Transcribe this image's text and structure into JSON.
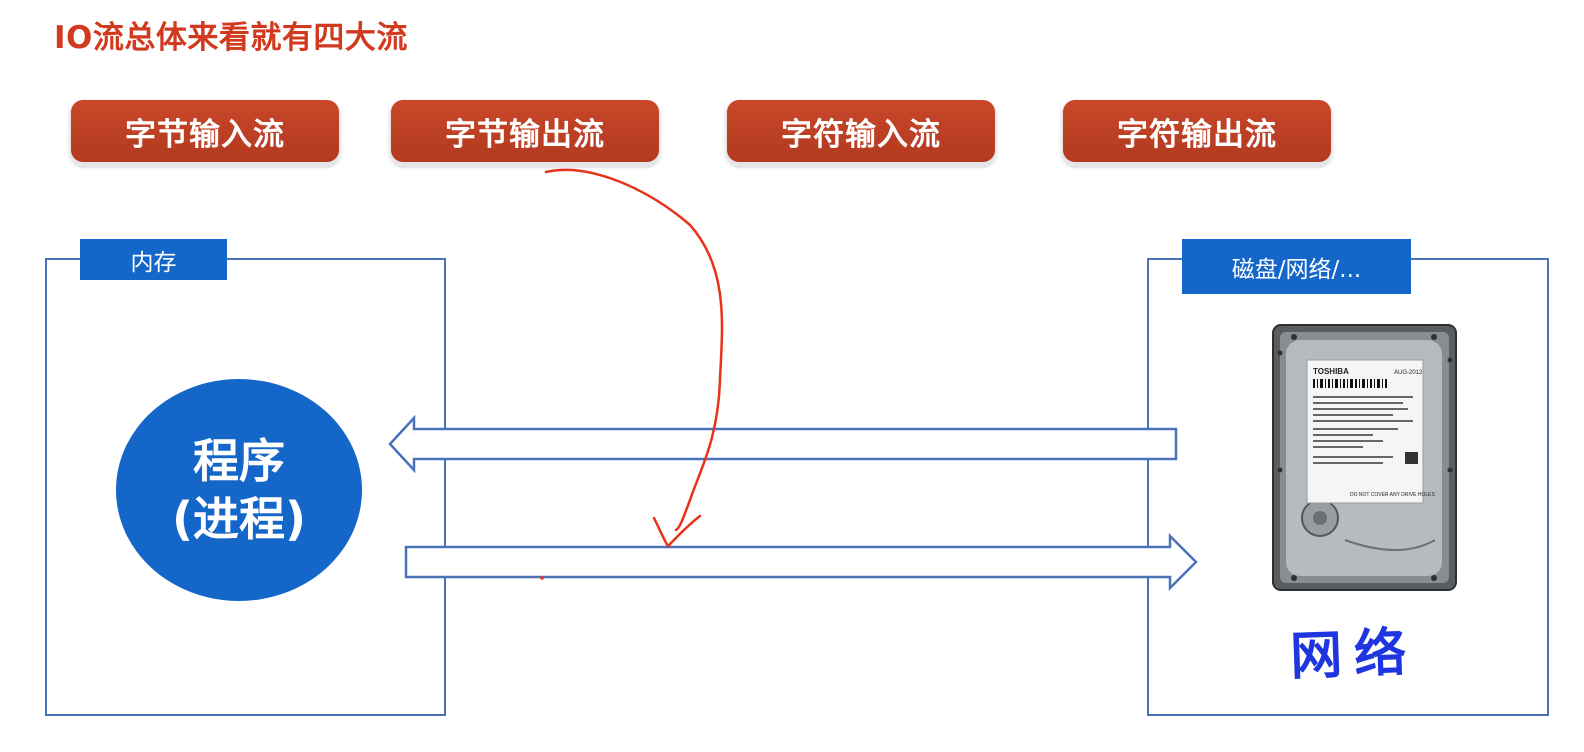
{
  "title": "IO流总体来看就有四大流",
  "streams": [
    {
      "label": "字节输入流"
    },
    {
      "label": "字节输出流"
    },
    {
      "label": "字符输入流"
    },
    {
      "label": "字符输出流"
    }
  ],
  "left_panel": {
    "label": "内存"
  },
  "right_panel": {
    "label": "磁盘/网络/..."
  },
  "program": {
    "line1": "程序",
    "line2": "(进程)"
  },
  "handwritten_note": "网络",
  "disk_label": {
    "brand": "TOSHIBA",
    "code": "AUG-2012",
    "warning": "DO NOT COVER ANY DRIVE HOLES"
  },
  "colors": {
    "title": "#d23a1f",
    "stream_button": "#c0422a",
    "panel_border": "#4a72b8",
    "panel_label": "#1466c8",
    "circle": "#1466c8",
    "annotation": "#e8321a",
    "handwriting": "#1f35e0"
  }
}
